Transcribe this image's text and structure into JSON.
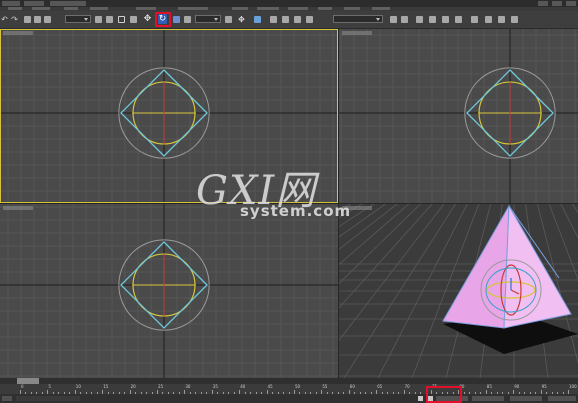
{
  "app": {
    "name": "3ds Max",
    "accent_highlight": "#e2102b"
  },
  "toolbar": {
    "highlighted_button_icon": "select-and-rotate-icon"
  },
  "viewports": [
    {
      "id": "top",
      "content": "wireframe-pyramid-with-sphere"
    },
    {
      "id": "front",
      "content": "wireframe-pyramid-with-sphere"
    },
    {
      "id": "left",
      "content": "wireframe-pyramid-with-sphere"
    },
    {
      "id": "perspective",
      "content": "shaded-pyramid-with-rotate-gizmo",
      "object_color": "#e8a6e8"
    }
  ],
  "timeline": {
    "ticks": [
      "0",
      "5",
      "10",
      "15",
      "20",
      "25",
      "30",
      "35",
      "40",
      "45",
      "50",
      "55",
      "60",
      "65",
      "70",
      "75",
      "80",
      "85",
      "90",
      "95",
      "100"
    ]
  },
  "watermark": {
    "logo": "GXI网",
    "url": "system.com"
  }
}
